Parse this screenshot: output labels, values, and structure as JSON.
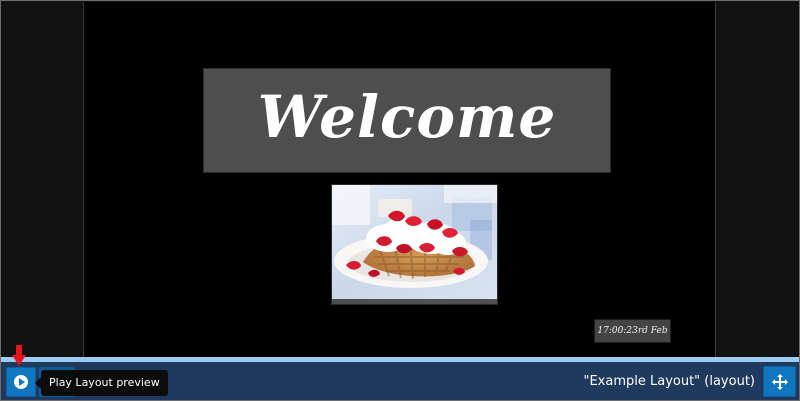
{
  "canvas": {
    "welcome_text": "Welcome",
    "clock_text": "17:00:23rd Feb"
  },
  "toolbar": {
    "tooltip": "Play Layout preview",
    "layout_title": "\"Example Layout\" (layout)"
  },
  "icons": {
    "play": "play-circle-icon",
    "move": "move-arrows-icon",
    "annotation": "red-down-arrow-icon"
  },
  "colors": {
    "canvas_background": "#000000",
    "outer_background": "#111111",
    "region_gray": "#4e4e4e",
    "toolbar_background": "#1f3a5e",
    "accent_strip": "#9ecbf2",
    "button_blue": "#0f76bf",
    "tooltip_background": "#0c0c0c",
    "annotation_red": "#e4161b"
  }
}
